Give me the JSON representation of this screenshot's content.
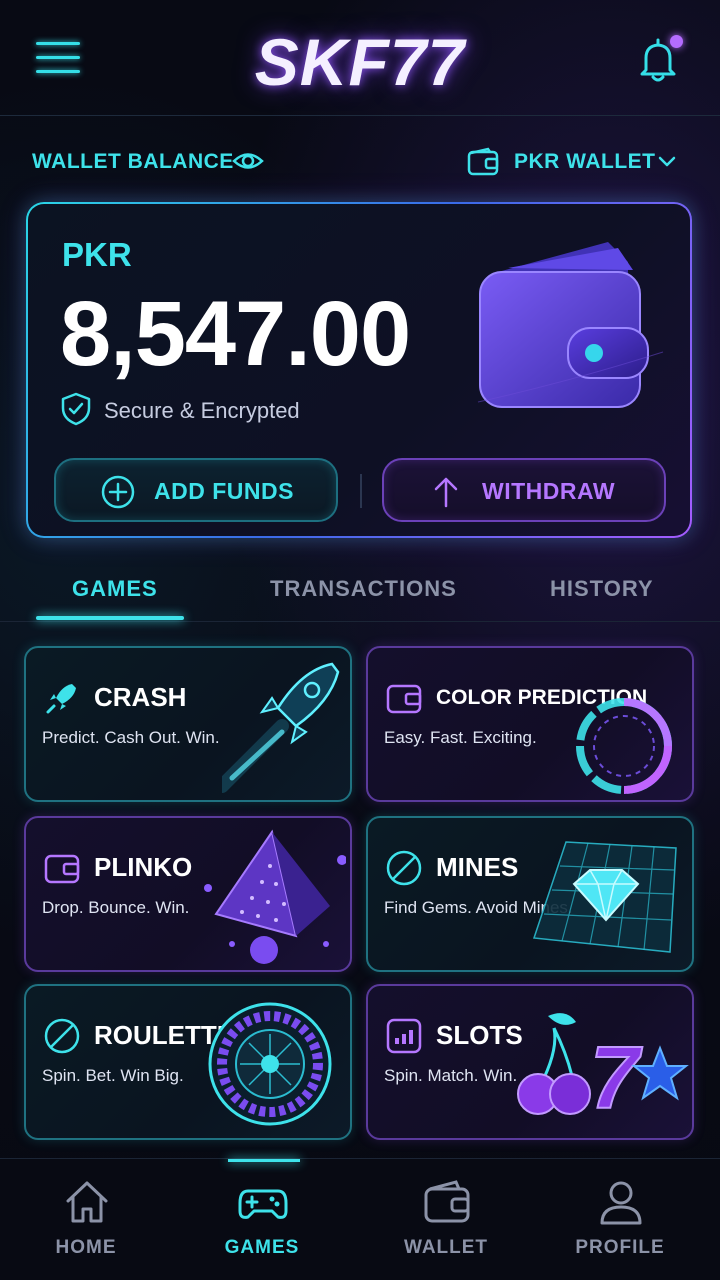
{
  "header": {
    "logo": "SKF77",
    "menu_icon": "hamburger-menu-icon",
    "bell_icon": "bell-icon"
  },
  "wallet_row": {
    "label": "WALLET BALANCE",
    "eye_icon": "eye-icon",
    "selector_label": "PKR WALLET"
  },
  "balance_card": {
    "currency": "PKR",
    "amount": "8,547.00",
    "secure_text": "Secure & Encrypted",
    "add_funds_label": "ADD FUNDS",
    "withdraw_label": "WITHDRAW"
  },
  "tabs": [
    {
      "label": "GAMES",
      "active": true
    },
    {
      "label": "TRANSACTIONS",
      "active": false
    },
    {
      "label": "HISTORY",
      "active": false
    }
  ],
  "games": [
    {
      "title": "CRASH",
      "subtitle": "Predict. Cash Out. Win.",
      "icon": "rocket-icon"
    },
    {
      "title": "COLOR PREDICTION",
      "subtitle": "Easy. Fast. Exciting.",
      "icon": "wallet-icon"
    },
    {
      "title": "PLINKO",
      "subtitle": "Drop. Bounce. Win.",
      "icon": "wallet-icon"
    },
    {
      "title": "MINES",
      "subtitle": "Find Gems. Avoid Mines.",
      "icon": "compass-icon"
    },
    {
      "title": "ROULETTE",
      "subtitle": "Spin. Bet. Win Big.",
      "icon": "compass-icon"
    },
    {
      "title": "SLOTS",
      "subtitle": "Spin. Match. Win.",
      "icon": "grid-icon"
    }
  ],
  "bottom_nav": [
    {
      "label": "HOME",
      "icon": "home-icon",
      "active": false
    },
    {
      "label": "GAMES",
      "icon": "gamepad-icon",
      "active": true
    },
    {
      "label": "WALLET",
      "icon": "wallet-icon",
      "active": false
    },
    {
      "label": "PROFILE",
      "icon": "user-icon",
      "active": false
    }
  ],
  "colors": {
    "accent_cyan": "#3ee2ea",
    "accent_purple": "#a45cff",
    "background": "#070912"
  }
}
